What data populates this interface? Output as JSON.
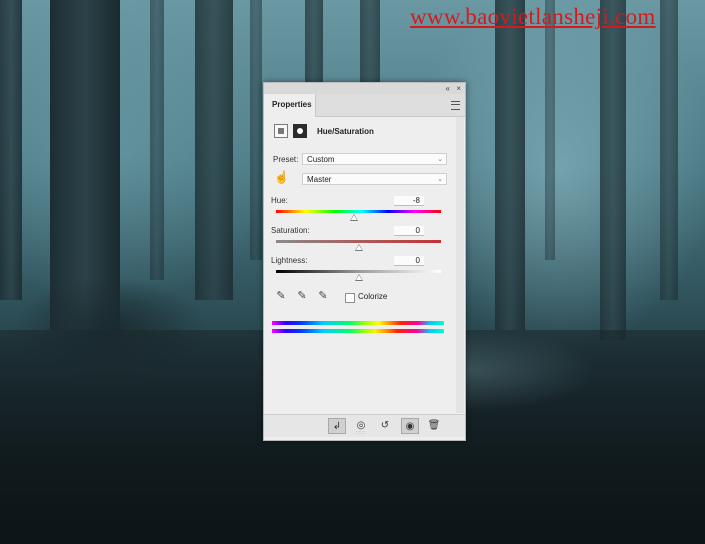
{
  "watermark": "www.baovietlansheji.com",
  "panel": {
    "title": "Properties",
    "adjustment_title": "Hue/Saturation",
    "preset_label": "Preset:",
    "preset_value": "Custom",
    "channel_value": "Master",
    "hue": {
      "label": "Hue:",
      "value": "-8",
      "fraction": 0.47
    },
    "saturation": {
      "label": "Saturation:",
      "value": "0",
      "fraction": 0.5
    },
    "lightness": {
      "label": "Lightness:",
      "value": "0",
      "fraction": 0.5
    },
    "colorize_label": "Colorize",
    "colorize_checked": false
  },
  "icons": {
    "collapse": "«",
    "close": "×",
    "chevron": "⌄",
    "hand": "☝",
    "eyedropper": "✎",
    "eyedropper_plus": "✎",
    "eyedropper_minus": "✎",
    "clip": "↲",
    "view_previous": "◎",
    "reset": "↺",
    "visibility": "◉",
    "delete": "🗑"
  }
}
